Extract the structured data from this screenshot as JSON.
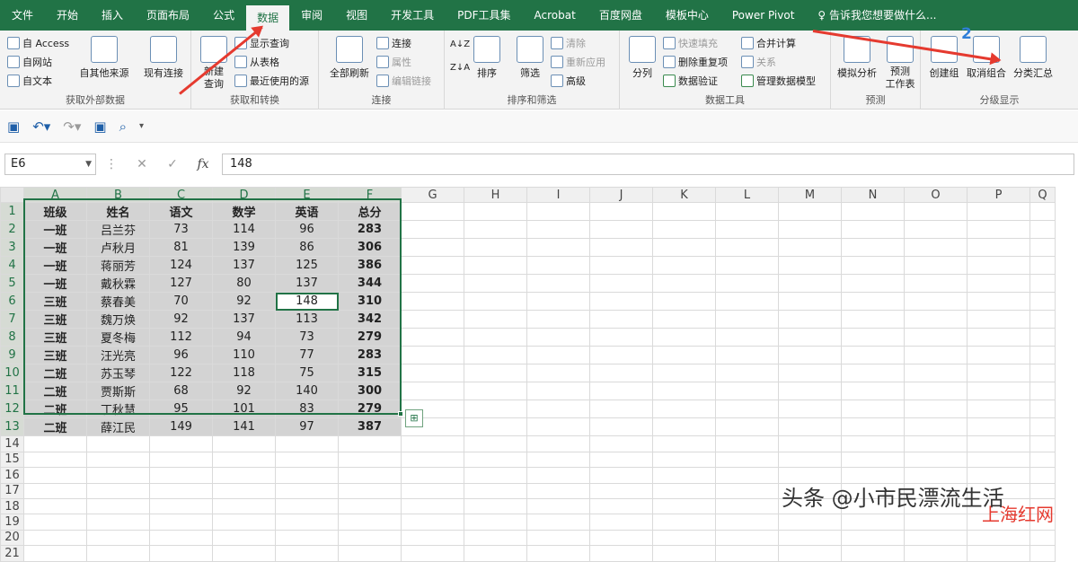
{
  "tabs": [
    "文件",
    "开始",
    "插入",
    "页面布局",
    "公式",
    "数据",
    "审阅",
    "视图",
    "开发工具",
    "PDF工具集",
    "Acrobat",
    "百度网盘",
    "模板中心",
    "Power Pivot"
  ],
  "active_tab": "数据",
  "tell_me": "告诉我您想要做什么...",
  "ribbon": {
    "get_external": {
      "label": "获取外部数据",
      "access": "自 Access",
      "web": "自网站",
      "text": "自文本",
      "other": "自其他来源",
      "existing": "现有连接"
    },
    "get_transform": {
      "label": "获取和转换",
      "new_query": "新建\n查询",
      "show_queries": "显示查询",
      "from_table": "从表格",
      "recent": "最近使用的源"
    },
    "connections": {
      "label": "连接",
      "refresh_all": "全部刷新",
      "connections": "连接",
      "properties": "属性",
      "edit_links": "编辑链接"
    },
    "sort_filter": {
      "label": "排序和筛选",
      "sort": "排序",
      "filter": "筛选",
      "clear": "清除",
      "reapply": "重新应用",
      "advanced": "高级"
    },
    "data_tools": {
      "label": "数据工具",
      "split": "分列",
      "flash_fill": "快速填充",
      "remove_dup": "删除重复项",
      "validate": "数据验证",
      "consolidate": "合并计算",
      "relations": "关系",
      "manage_model": "管理数据模型"
    },
    "forecast": {
      "label": "预测",
      "what_if": "模拟分析",
      "forecast_sheet": "预测\n工作表"
    },
    "outline": {
      "label": "分级显示",
      "group": "创建组",
      "ungroup": "取消组合",
      "subtotal": "分类汇总"
    }
  },
  "formula_bar": {
    "name_box": "E6",
    "fx": "fx",
    "value": "148"
  },
  "columns": [
    "A",
    "B",
    "C",
    "D",
    "E",
    "F",
    "G",
    "H",
    "I",
    "J",
    "K",
    "L",
    "M",
    "N",
    "O",
    "P",
    "Q"
  ],
  "table": {
    "headers": [
      "班级",
      "姓名",
      "语文",
      "数学",
      "英语",
      "总分"
    ],
    "rows": [
      [
        "一班",
        "吕兰芬",
        "73",
        "114",
        "96",
        "283"
      ],
      [
        "一班",
        "卢秋月",
        "81",
        "139",
        "86",
        "306"
      ],
      [
        "一班",
        "蒋丽芳",
        "124",
        "137",
        "125",
        "386"
      ],
      [
        "一班",
        "戴秋霖",
        "127",
        "80",
        "137",
        "344"
      ],
      [
        "三班",
        "蔡春美",
        "70",
        "92",
        "148",
        "310"
      ],
      [
        "三班",
        "魏万焕",
        "92",
        "137",
        "113",
        "342"
      ],
      [
        "三班",
        "夏冬梅",
        "112",
        "94",
        "73",
        "279"
      ],
      [
        "三班",
        "汪光亮",
        "96",
        "110",
        "77",
        "283"
      ],
      [
        "二班",
        "苏玉琴",
        "122",
        "118",
        "75",
        "315"
      ],
      [
        "二班",
        "贾斯斯",
        "68",
        "92",
        "140",
        "300"
      ],
      [
        "二班",
        "丁秋慧",
        "95",
        "101",
        "83",
        "279"
      ],
      [
        "二班",
        "薛江民",
        "149",
        "141",
        "97",
        "387"
      ]
    ]
  },
  "annotation_number": "2",
  "watermark": "头条 @小市民漂流生活",
  "watermark2": "上海红网",
  "colors": {
    "excel_green": "#217346",
    "arrow_red": "#e53a2f",
    "selection_gray": "#d3d3d3"
  }
}
